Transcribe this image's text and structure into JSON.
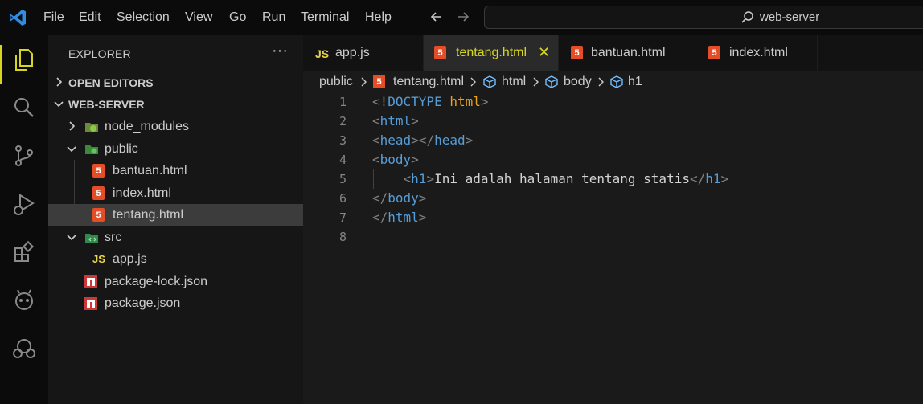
{
  "menu": [
    "File",
    "Edit",
    "Selection",
    "View",
    "Go",
    "Run",
    "Terminal",
    "Help"
  ],
  "command_center": {
    "label": "web-server",
    "icon": "search-icon"
  },
  "activity_bar": [
    "explorer-icon",
    "search-icon",
    "source-control-icon",
    "run-debug-icon",
    "extensions-icon",
    "remote-icon",
    "accounts-icon"
  ],
  "explorer": {
    "title": "EXPLORER",
    "more": "···",
    "sections": {
      "open_editors": "OPEN EDITORS",
      "workspace": "WEB-SERVER"
    },
    "tree": [
      {
        "label": "node_modules",
        "type": "folder",
        "expanded": false
      },
      {
        "label": "public",
        "type": "folder",
        "expanded": true
      },
      {
        "label": "bantuan.html",
        "type": "html"
      },
      {
        "label": "index.html",
        "type": "html"
      },
      {
        "label": "tentang.html",
        "type": "html",
        "selected": true
      },
      {
        "label": "src",
        "type": "folder",
        "expanded": true
      },
      {
        "label": "app.js",
        "type": "js"
      },
      {
        "label": "package-lock.json",
        "type": "npm"
      },
      {
        "label": "package.json",
        "type": "npm"
      }
    ]
  },
  "tabs": [
    {
      "label": "app.js",
      "icon": "JS",
      "active": false
    },
    {
      "label": "tentang.html",
      "icon": "5",
      "active": true,
      "close": "✕"
    },
    {
      "label": "bantuan.html",
      "icon": "5",
      "active": false
    },
    {
      "label": "index.html",
      "icon": "5",
      "active": false
    }
  ],
  "breadcrumb": [
    "public",
    "tentang.html",
    "html",
    "body",
    "h1"
  ],
  "editor": {
    "line_numbers": [
      "1",
      "2",
      "3",
      "4",
      "5",
      "6",
      "7",
      "8"
    ],
    "lines": [
      [
        {
          "c": "b",
          "t": "<!"
        },
        {
          "c": "d",
          "t": "DOCTYPE "
        },
        {
          "c": "k",
          "t": "html"
        },
        {
          "c": "b",
          "t": ">"
        }
      ],
      [
        {
          "c": "b",
          "t": "<"
        },
        {
          "c": "g",
          "t": "html"
        },
        {
          "c": "b",
          "t": ">"
        }
      ],
      [
        {
          "c": "b",
          "t": "<"
        },
        {
          "c": "g",
          "t": "head"
        },
        {
          "c": "b",
          "t": "></"
        },
        {
          "c": "g",
          "t": "head"
        },
        {
          "c": "b",
          "t": ">"
        }
      ],
      [
        {
          "c": "b",
          "t": "<"
        },
        {
          "c": "g",
          "t": "body"
        },
        {
          "c": "b",
          "t": ">"
        }
      ],
      [
        {
          "c": "x",
          "t": "    "
        },
        {
          "c": "b",
          "t": "<"
        },
        {
          "c": "g",
          "t": "h1"
        },
        {
          "c": "b",
          "t": ">"
        },
        {
          "c": "x",
          "t": "Ini adalah halaman tentang statis"
        },
        {
          "c": "b",
          "t": "</"
        },
        {
          "c": "g",
          "t": "h1"
        },
        {
          "c": "b",
          "t": ">"
        }
      ],
      [
        {
          "c": "b",
          "t": "</"
        },
        {
          "c": "g",
          "t": "body"
        },
        {
          "c": "b",
          "t": ">"
        }
      ],
      [
        {
          "c": "b",
          "t": "</"
        },
        {
          "c": "g",
          "t": "html"
        },
        {
          "c": "b",
          "t": ">"
        }
      ],
      []
    ]
  },
  "colors": {
    "accent": "#d7d51f",
    "html_icon": "#e44d26",
    "npm_icon": "#cb3837",
    "js_icon": "#e8d44d"
  }
}
